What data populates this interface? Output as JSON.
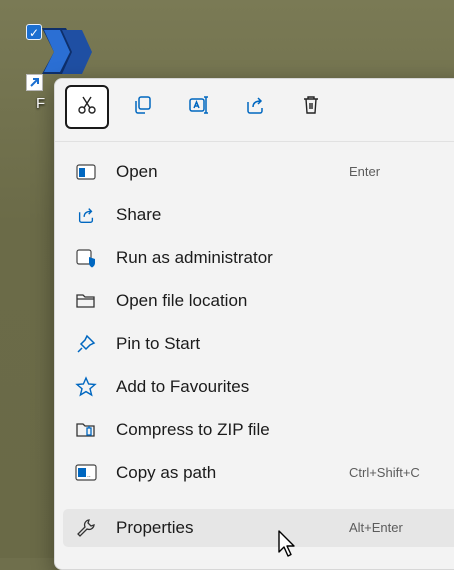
{
  "desktop": {
    "icon_label": "F"
  },
  "toolbar": {
    "cut": {
      "icon": "scissors-icon"
    },
    "copy": {
      "icon": "copy-icon"
    },
    "rename": {
      "icon": "rename-icon"
    },
    "share": {
      "icon": "share-icon"
    },
    "delete": {
      "icon": "trash-icon"
    }
  },
  "menu": {
    "items": [
      {
        "label": "Open",
        "accel": "Enter",
        "icon": "open-window-icon"
      },
      {
        "label": "Share",
        "accel": "",
        "icon": "share-icon"
      },
      {
        "label": "Run as administrator",
        "accel": "",
        "icon": "admin-shield-icon"
      },
      {
        "label": "Open file location",
        "accel": "",
        "icon": "folder-icon"
      },
      {
        "label": "Pin to Start",
        "accel": "",
        "icon": "pin-icon"
      },
      {
        "label": "Add to Favourites",
        "accel": "",
        "icon": "star-icon"
      },
      {
        "label": "Compress to ZIP file",
        "accel": "",
        "icon": "zip-icon"
      },
      {
        "label": "Copy as path",
        "accel": "Ctrl+Shift+C",
        "icon": "path-icon"
      },
      {
        "label": "Properties",
        "accel": "Alt+Enter",
        "icon": "wrench-icon"
      }
    ]
  },
  "colors": {
    "accent": "#0067c0",
    "menu_bg": "#f3f3f3",
    "desktop_bg": "#6f6f4c"
  }
}
